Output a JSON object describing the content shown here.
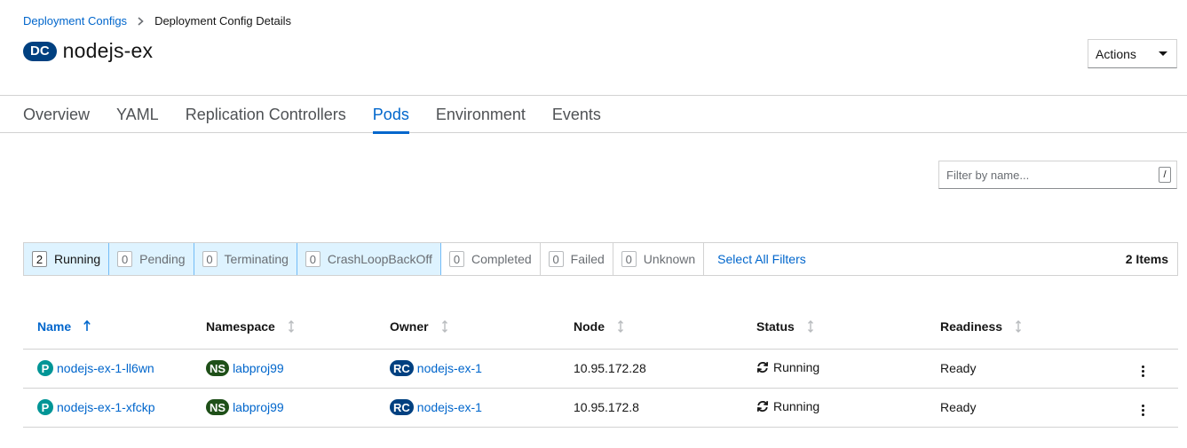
{
  "breadcrumb": {
    "parent": "Deployment Configs",
    "current": "Deployment Config Details"
  },
  "header": {
    "badge": "DC",
    "title": "nodejs-ex",
    "actions_label": "Actions"
  },
  "tabs": [
    {
      "label": "Overview"
    },
    {
      "label": "YAML"
    },
    {
      "label": "Replication Controllers"
    },
    {
      "label": "Pods",
      "active": true
    },
    {
      "label": "Environment"
    },
    {
      "label": "Events"
    }
  ],
  "filter": {
    "placeholder": "Filter by name...",
    "shortcut": "/"
  },
  "row_filters": [
    {
      "count": "2",
      "label": "Running"
    },
    {
      "count": "0",
      "label": "Pending"
    },
    {
      "count": "0",
      "label": "Terminating"
    },
    {
      "count": "0",
      "label": "CrashLoopBackOff"
    },
    {
      "count": "0",
      "label": "Completed"
    },
    {
      "count": "0",
      "label": "Failed"
    },
    {
      "count": "0",
      "label": "Unknown"
    }
  ],
  "select_all_label": "Select All Filters",
  "items_count": "2 Items",
  "table": {
    "columns": [
      "Name",
      "Namespace",
      "Owner",
      "Node",
      "Status",
      "Readiness"
    ],
    "rows": [
      {
        "pod_badge": "P",
        "name": "nodejs-ex-1-ll6wn",
        "ns_badge": "NS",
        "namespace": "labproj99",
        "rc_badge": "RC",
        "owner": "nodejs-ex-1",
        "node": "10.95.172.28",
        "status": "Running",
        "readiness": "Ready"
      },
      {
        "pod_badge": "P",
        "name": "nodejs-ex-1-xfckp",
        "ns_badge": "NS",
        "namespace": "labproj99",
        "rc_badge": "RC",
        "owner": "nodejs-ex-1",
        "node": "10.95.172.8",
        "status": "Running",
        "readiness": "Ready"
      }
    ]
  },
  "colors": {
    "link": "#0066cc",
    "active_filter_bg": "#def3ff",
    "pod_badge": "#009596",
    "ns_badge": "#1e4f18",
    "rc_badge": "#004080"
  }
}
